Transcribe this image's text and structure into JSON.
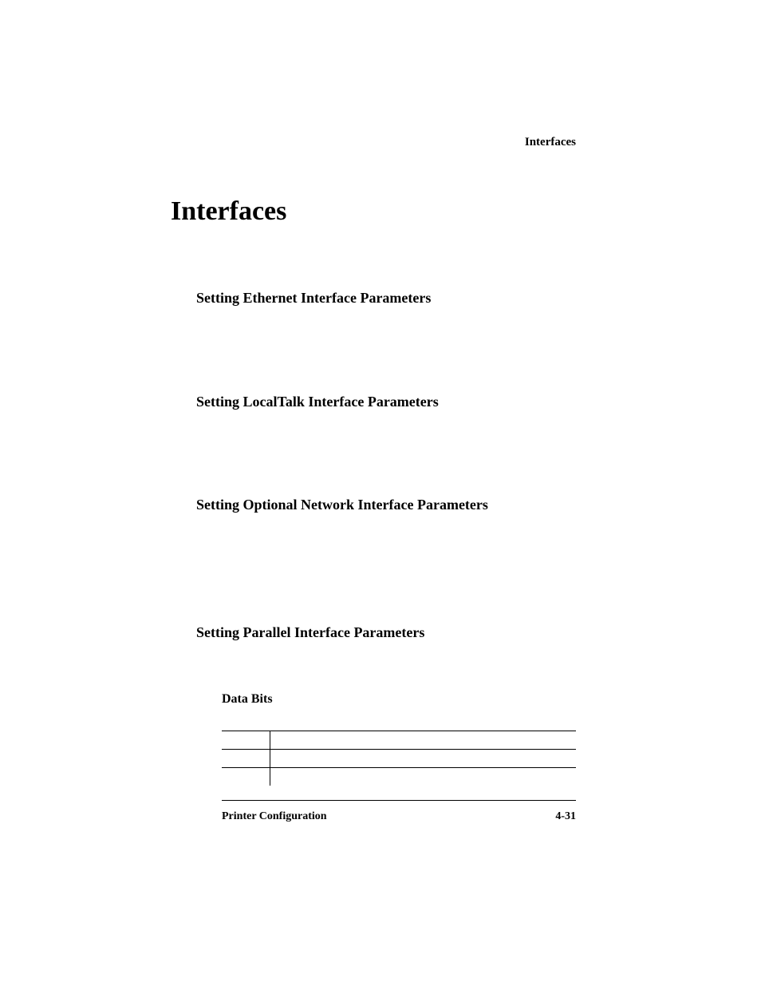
{
  "runningHeader": "Interfaces",
  "title": "Interfaces",
  "sections": {
    "ethernet": "Setting Ethernet Interface Parameters",
    "localtalk": "Setting LocalTalk Interface Parameters",
    "optional": "Setting Optional Network Interface Parameters",
    "parallel": "Setting Parallel Interface Parameters"
  },
  "subsection": "Data Bits",
  "footer": {
    "left": "Printer Configuration",
    "right": "4-31"
  }
}
